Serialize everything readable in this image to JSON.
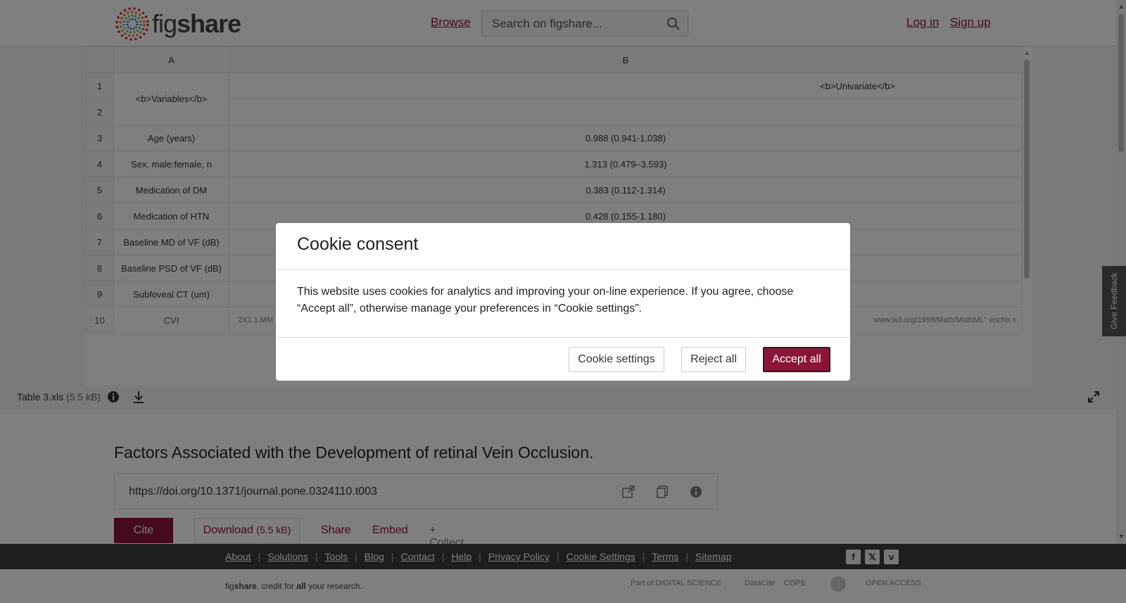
{
  "header": {
    "logo_text_fig": "fig",
    "logo_text_share": "share",
    "browse": "Browse",
    "search_placeholder": "Search on figshare...",
    "login": "Log in",
    "signup": "Sign up"
  },
  "sheet": {
    "col_a": "A",
    "col_b": "B",
    "rows": [
      {
        "n": "1",
        "a": "<b>Variables</b>",
        "b": "<b>Univariate</b>"
      },
      {
        "n": "2",
        "a": "",
        "b": ""
      },
      {
        "n": "3",
        "a": "Age (years)",
        "b": "0.988 (0.941-1.038)"
      },
      {
        "n": "4",
        "a": "Sex, male:female, n",
        "b": "1.313 (0.479–3.593)"
      },
      {
        "n": "5",
        "a": "Medication of DM",
        "b": "0.383 (0.112-1.314)"
      },
      {
        "n": "6",
        "a": "Medication of HTN",
        "b": "0.428 (0.155-1.180)"
      },
      {
        "n": "7",
        "a": "Baseline MD of VF (dB)",
        "b": ""
      },
      {
        "n": "8",
        "a": "Baseline PSD of VF (dB)",
        "b": ""
      },
      {
        "n": "9",
        "a": "Subfoveal CT (um)",
        "b": ""
      },
      {
        "n": "10",
        "a": "CVI",
        "b": ""
      }
    ],
    "row10_b_left": "2X1.1.MM",
    "row10_b_right": "www.w3.org/1998/Math/MathML\" ",
    "row10_b_partial": "encho x"
  },
  "file": {
    "name": "Table 3.xls",
    "size": "(5.5 kB)"
  },
  "article": {
    "title": "Factors Associated with the Development of retinal Vein Occlusion.",
    "doi": "https://doi.org/10.1371/journal.pone.0324110.t003",
    "cite": "Cite",
    "download": "Download",
    "download_size": "(5.5 kB)",
    "share": "Share",
    "embed": "Embed",
    "collect": "+ Collect"
  },
  "footer": {
    "links": [
      "About",
      "Solutions",
      "Tools",
      "Blog",
      "Contact",
      "Help",
      "Privacy Policy",
      "Cookie Settings",
      "Terms",
      "Sitemap"
    ],
    "tagline_fig": "fig",
    "tagline_share": "share",
    "tagline_rest1": ". credit for ",
    "tagline_all": "all",
    "tagline_rest2": " your research.",
    "partner_ds": "Part of DIGITAL SCIENCE",
    "partner_datacite": "DataCite",
    "partner_cope": "COPE",
    "partner_open": "OPEN ACCESS"
  },
  "feedback": "Give Feedback",
  "cookie": {
    "title": "Cookie consent",
    "body": "This website uses cookies for analytics and improving your on-line experience. If you agree, choose “Accept all”, otherwise manage your preferences in “Cookie settings”.",
    "settings": "Cookie settings",
    "reject": "Reject all",
    "accept": "Accept all"
  },
  "colors": {
    "brand": "#8a1538",
    "footer_bg": "#3d3d3d"
  }
}
